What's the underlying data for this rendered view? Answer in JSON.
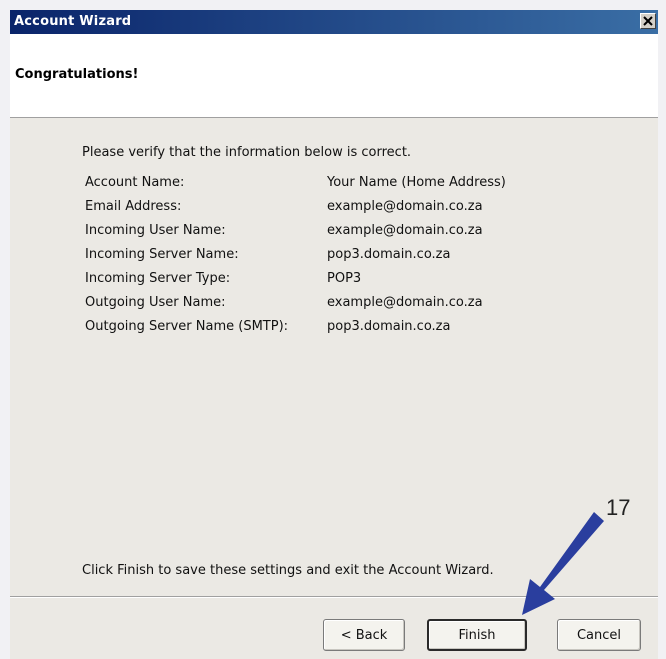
{
  "window": {
    "title": "Account Wizard"
  },
  "header": {
    "title": "Congratulations!"
  },
  "content": {
    "intro": "Please verify that the information below is correct.",
    "rows": [
      {
        "label": "Account Name:",
        "value": "Your Name (Home Address)"
      },
      {
        "label": "Email Address:",
        "value": "example@domain.co.za"
      },
      {
        "label": "Incoming User Name:",
        "value": "example@domain.co.za"
      },
      {
        "label": "Incoming Server Name:",
        "value": "pop3.domain.co.za"
      },
      {
        "label": "Incoming Server Type:",
        "value": "POP3"
      },
      {
        "label": "Outgoing User Name:",
        "value": "example@domain.co.za"
      },
      {
        "label": "Outgoing Server Name (SMTP):",
        "value": "pop3.domain.co.za"
      }
    ],
    "finish_note": "Click Finish to save these settings and exit the Account Wizard."
  },
  "buttons": {
    "back": "< Back",
    "finish": "Finish",
    "cancel": "Cancel"
  },
  "annotation": {
    "step_number": "17",
    "arrow_color": "#2a3e9e",
    "icon": "arrow-icon"
  }
}
